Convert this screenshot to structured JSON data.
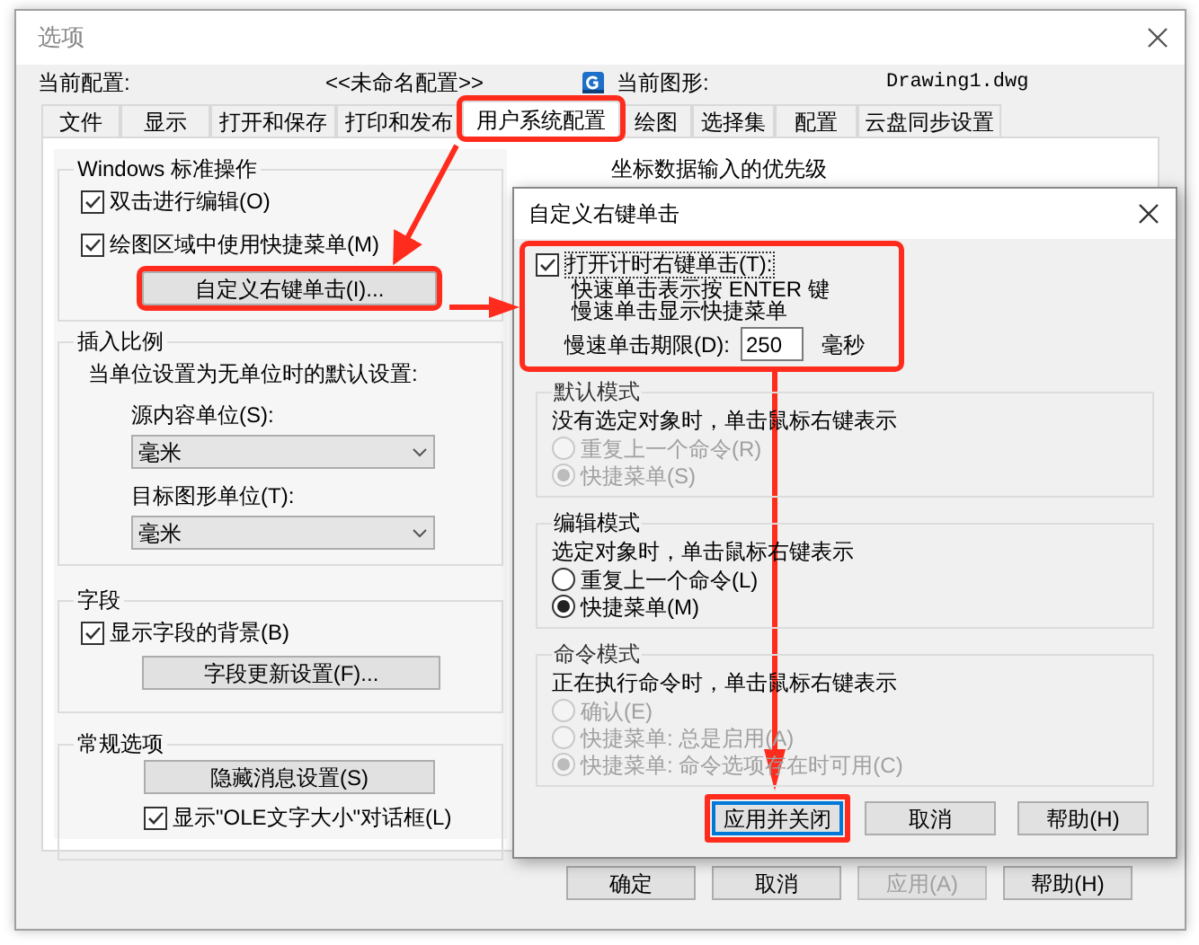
{
  "window": {
    "title": "选项"
  },
  "header": {
    "profile_label": "当前配置:",
    "profile": "<<未命名配置>>",
    "drawing_label": "当前图形:",
    "drawing": "Drawing1.dwg"
  },
  "tabs": [
    {
      "label": "文件",
      "selected": false
    },
    {
      "label": "显示",
      "selected": false
    },
    {
      "label": "打开和保存",
      "selected": false
    },
    {
      "label": "打印和发布",
      "selected": false
    },
    {
      "label": "用户系统配置",
      "selected": true,
      "highlighted": true
    },
    {
      "label": "绘图",
      "selected": false
    },
    {
      "label": "选择集",
      "selected": false
    },
    {
      "label": "配置",
      "selected": false
    },
    {
      "label": "云盘同步设置",
      "selected": false
    }
  ],
  "windows_group": {
    "title": "Windows 标准操作",
    "checkboxes": [
      {
        "label": "双击进行编辑(O)",
        "checked": true
      },
      {
        "label": "绘图区域中使用快捷菜单(M)",
        "checked": true
      }
    ],
    "button": {
      "label": "自定义右键单击(I)...",
      "highlighted": true
    }
  },
  "insert_scale": {
    "title": "插入比例",
    "note": "当单位设置为无单位时的默认设置:",
    "fields": [
      {
        "label": "源内容单位(S):",
        "value": "毫米"
      },
      {
        "label": "目标图形单位(T):",
        "value": "毫米"
      }
    ]
  },
  "fields_group": {
    "title": "字段",
    "checkbox": {
      "label": "显示字段的背景(B)",
      "checked": true
    },
    "button": "字段更新设置(F)..."
  },
  "general_group": {
    "title": "常规选项",
    "button": "隐藏消息设置(S)",
    "checkbox": {
      "label": "显示\"OLE文字大小\"对话框(L)",
      "checked": true
    }
  },
  "right_group": {
    "title": "坐标数据输入的优先级"
  },
  "buttons": [
    {
      "label": "确定",
      "disabled": false
    },
    {
      "label": "取消",
      "disabled": false
    },
    {
      "label": "应用(A)",
      "disabled": true
    },
    {
      "label": "帮助(H)",
      "disabled": false
    }
  ],
  "subdialog": {
    "title": "自定义右键单击",
    "timed": {
      "label": "打开计时右键单击(T):",
      "checked": true,
      "lines": [
        "快速单击表示按 ENTER 键",
        "慢速单击显示快捷菜单"
      ],
      "period_label": "慢速单击期限(D):",
      "period": "250",
      "unit": "毫秒"
    },
    "modes": [
      {
        "title": "默认模式",
        "note": "没有选定对象时，单击鼠标右键表示",
        "disabled": true,
        "options": [
          {
            "label": "重复上一个命令(R)",
            "selected": false
          },
          {
            "label": "快捷菜单(S)",
            "selected": true
          }
        ]
      },
      {
        "title": "编辑模式",
        "note": "选定对象时，单击鼠标右键表示",
        "disabled": false,
        "options": [
          {
            "label": "重复上一个命令(L)",
            "selected": false
          },
          {
            "label": "快捷菜单(M)",
            "selected": true
          }
        ]
      },
      {
        "title": "命令模式",
        "note": "正在执行命令时，单击鼠标右键表示",
        "disabled": true,
        "options": [
          {
            "label": "确认(E)",
            "selected": false
          },
          {
            "label": "快捷菜单: 总是启用(A)",
            "selected": false
          },
          {
            "label": "快捷菜单: 命令选项存在时可用(C)",
            "selected": true
          }
        ]
      }
    ],
    "buttons": [
      {
        "label": "应用并关闭",
        "focused": true,
        "highlighted": true
      },
      {
        "label": "取消",
        "focused": false,
        "highlighted": false
      },
      {
        "label": "帮助(H)",
        "focused": false,
        "highlighted": false
      }
    ]
  }
}
